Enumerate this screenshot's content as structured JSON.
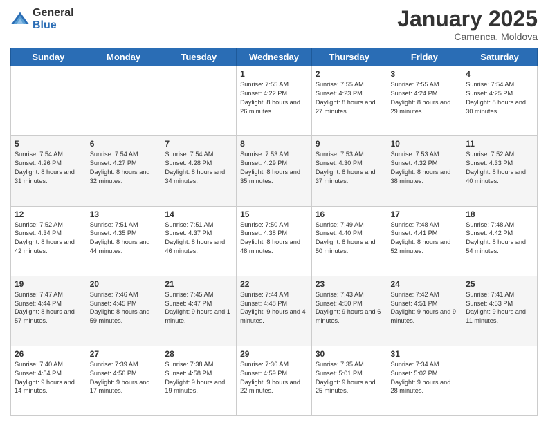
{
  "logo": {
    "general": "General",
    "blue": "Blue"
  },
  "header": {
    "month": "January 2025",
    "location": "Camenca, Moldova"
  },
  "weekdays": [
    "Sunday",
    "Monday",
    "Tuesday",
    "Wednesday",
    "Thursday",
    "Friday",
    "Saturday"
  ],
  "weeks": [
    [
      {
        "day": "",
        "info": ""
      },
      {
        "day": "",
        "info": ""
      },
      {
        "day": "",
        "info": ""
      },
      {
        "day": "1",
        "info": "Sunrise: 7:55 AM\nSunset: 4:22 PM\nDaylight: 8 hours\nand 26 minutes."
      },
      {
        "day": "2",
        "info": "Sunrise: 7:55 AM\nSunset: 4:23 PM\nDaylight: 8 hours\nand 27 minutes."
      },
      {
        "day": "3",
        "info": "Sunrise: 7:55 AM\nSunset: 4:24 PM\nDaylight: 8 hours\nand 29 minutes."
      },
      {
        "day": "4",
        "info": "Sunrise: 7:54 AM\nSunset: 4:25 PM\nDaylight: 8 hours\nand 30 minutes."
      }
    ],
    [
      {
        "day": "5",
        "info": "Sunrise: 7:54 AM\nSunset: 4:26 PM\nDaylight: 8 hours\nand 31 minutes."
      },
      {
        "day": "6",
        "info": "Sunrise: 7:54 AM\nSunset: 4:27 PM\nDaylight: 8 hours\nand 32 minutes."
      },
      {
        "day": "7",
        "info": "Sunrise: 7:54 AM\nSunset: 4:28 PM\nDaylight: 8 hours\nand 34 minutes."
      },
      {
        "day": "8",
        "info": "Sunrise: 7:53 AM\nSunset: 4:29 PM\nDaylight: 8 hours\nand 35 minutes."
      },
      {
        "day": "9",
        "info": "Sunrise: 7:53 AM\nSunset: 4:30 PM\nDaylight: 8 hours\nand 37 minutes."
      },
      {
        "day": "10",
        "info": "Sunrise: 7:53 AM\nSunset: 4:32 PM\nDaylight: 8 hours\nand 38 minutes."
      },
      {
        "day": "11",
        "info": "Sunrise: 7:52 AM\nSunset: 4:33 PM\nDaylight: 8 hours\nand 40 minutes."
      }
    ],
    [
      {
        "day": "12",
        "info": "Sunrise: 7:52 AM\nSunset: 4:34 PM\nDaylight: 8 hours\nand 42 minutes."
      },
      {
        "day": "13",
        "info": "Sunrise: 7:51 AM\nSunset: 4:35 PM\nDaylight: 8 hours\nand 44 minutes."
      },
      {
        "day": "14",
        "info": "Sunrise: 7:51 AM\nSunset: 4:37 PM\nDaylight: 8 hours\nand 46 minutes."
      },
      {
        "day": "15",
        "info": "Sunrise: 7:50 AM\nSunset: 4:38 PM\nDaylight: 8 hours\nand 48 minutes."
      },
      {
        "day": "16",
        "info": "Sunrise: 7:49 AM\nSunset: 4:40 PM\nDaylight: 8 hours\nand 50 minutes."
      },
      {
        "day": "17",
        "info": "Sunrise: 7:48 AM\nSunset: 4:41 PM\nDaylight: 8 hours\nand 52 minutes."
      },
      {
        "day": "18",
        "info": "Sunrise: 7:48 AM\nSunset: 4:42 PM\nDaylight: 8 hours\nand 54 minutes."
      }
    ],
    [
      {
        "day": "19",
        "info": "Sunrise: 7:47 AM\nSunset: 4:44 PM\nDaylight: 8 hours\nand 57 minutes."
      },
      {
        "day": "20",
        "info": "Sunrise: 7:46 AM\nSunset: 4:45 PM\nDaylight: 8 hours\nand 59 minutes."
      },
      {
        "day": "21",
        "info": "Sunrise: 7:45 AM\nSunset: 4:47 PM\nDaylight: 9 hours\nand 1 minute."
      },
      {
        "day": "22",
        "info": "Sunrise: 7:44 AM\nSunset: 4:48 PM\nDaylight: 9 hours\nand 4 minutes."
      },
      {
        "day": "23",
        "info": "Sunrise: 7:43 AM\nSunset: 4:50 PM\nDaylight: 9 hours\nand 6 minutes."
      },
      {
        "day": "24",
        "info": "Sunrise: 7:42 AM\nSunset: 4:51 PM\nDaylight: 9 hours\nand 9 minutes."
      },
      {
        "day": "25",
        "info": "Sunrise: 7:41 AM\nSunset: 4:53 PM\nDaylight: 9 hours\nand 11 minutes."
      }
    ],
    [
      {
        "day": "26",
        "info": "Sunrise: 7:40 AM\nSunset: 4:54 PM\nDaylight: 9 hours\nand 14 minutes."
      },
      {
        "day": "27",
        "info": "Sunrise: 7:39 AM\nSunset: 4:56 PM\nDaylight: 9 hours\nand 17 minutes."
      },
      {
        "day": "28",
        "info": "Sunrise: 7:38 AM\nSunset: 4:58 PM\nDaylight: 9 hours\nand 19 minutes."
      },
      {
        "day": "29",
        "info": "Sunrise: 7:36 AM\nSunset: 4:59 PM\nDaylight: 9 hours\nand 22 minutes."
      },
      {
        "day": "30",
        "info": "Sunrise: 7:35 AM\nSunset: 5:01 PM\nDaylight: 9 hours\nand 25 minutes."
      },
      {
        "day": "31",
        "info": "Sunrise: 7:34 AM\nSunset: 5:02 PM\nDaylight: 9 hours\nand 28 minutes."
      },
      {
        "day": "",
        "info": ""
      }
    ]
  ]
}
